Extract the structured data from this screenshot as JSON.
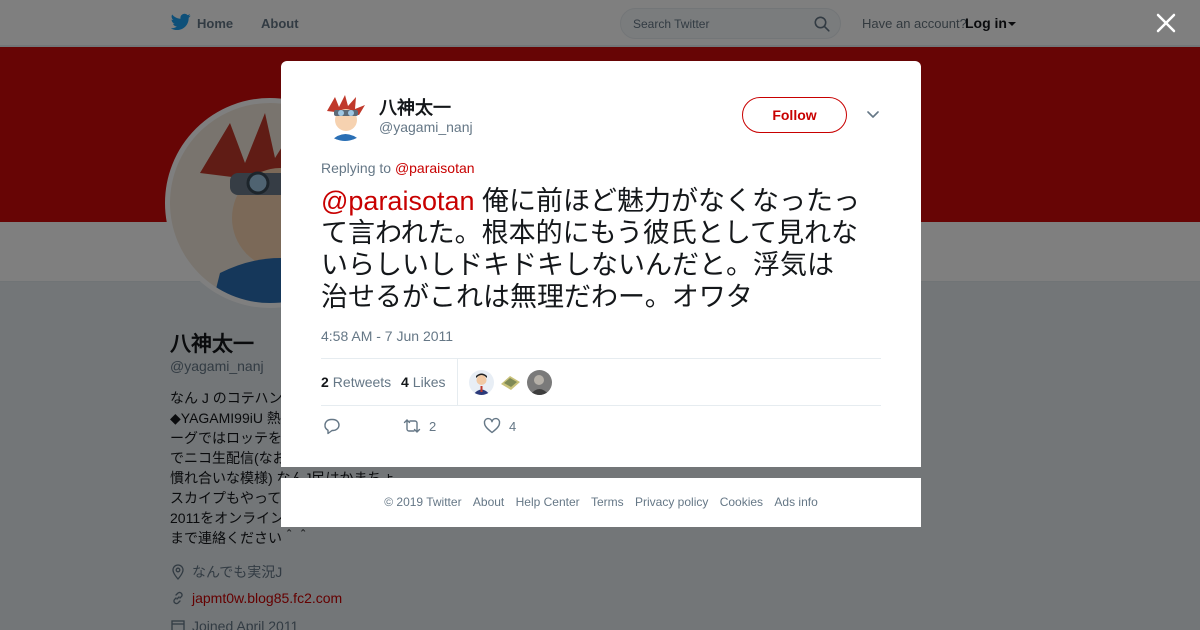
{
  "nav": {
    "home": "Home",
    "about": "About",
    "search_placeholder": "Search Twitter",
    "have_account": "Have an account?",
    "login": "Log in"
  },
  "profile": {
    "name": "八神太一",
    "handle": "@yagami_nanj",
    "bio_lines": [
      "なん J のコテハン",
      "◆YAGAMI99iU 熱",
      "ーグではロッテを",
      "でニコ生配信(なお",
      "慣れ合いな模様) なんJ民はかまちょ",
      "スカイプもやって",
      "2011をオンライン",
      "まで連絡ください＾＾"
    ],
    "location": "なんでも実況J",
    "url": "japmt0w.blog85.fc2.com",
    "joined": "Joined April 2011"
  },
  "tweet": {
    "author_name": "八神太一",
    "author_handle": "@yagami_nanj",
    "follow_label": "Follow",
    "replying_prefix": "Replying to",
    "replying_to": "@paraisotan",
    "mention": "@paraisotan",
    "text_lines": [
      " 俺に前ほど魅力がなくなったっ",
      "て言われた。根本的にもう彼氏として見れな",
      "いらしいしドキドキしないんだと。浮気は",
      "治せるがこれは無理だわー。オワタ"
    ],
    "timestamp": "4:58 AM - 7 Jun 2011",
    "retweets_count": "2",
    "retweets_label": "Retweets",
    "likes_count": "4",
    "likes_label": "Likes",
    "action_retweet_count": "2",
    "action_like_count": "4"
  },
  "footer": {
    "items": [
      "© 2019 Twitter",
      "About",
      "Help Center",
      "Terms",
      "Privacy policy",
      "Cookies",
      "Ads info"
    ]
  },
  "colors": {
    "accent": "#c80000",
    "banner": "#ce0a0a",
    "twitter_blue": "#1da1f2"
  }
}
